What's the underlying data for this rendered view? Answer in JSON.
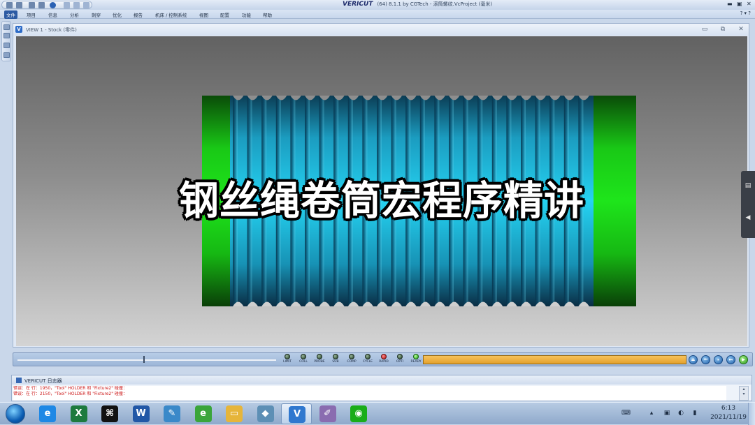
{
  "window": {
    "brand": "VERICUT",
    "title": "(64) 8.1.1 by CGTech - 滚筒螺纹.VcProject (毫米)",
    "controls": {
      "minimize": "▬",
      "restore": "▣",
      "close": "✕"
    }
  },
  "menu": {
    "items": [
      {
        "label": "文件",
        "active": true
      },
      {
        "label": "项目"
      },
      {
        "label": "信息"
      },
      {
        "label": "分析"
      },
      {
        "label": "刺穿"
      },
      {
        "label": "优化"
      },
      {
        "label": "报告"
      },
      {
        "label": "机床 / 控制系统"
      },
      {
        "label": "视图"
      },
      {
        "label": "配置"
      },
      {
        "label": "功能"
      },
      {
        "label": "帮助"
      }
    ],
    "help_icons": "? ▾ ?"
  },
  "view": {
    "title": "VIEW 1 - Stock (零件)",
    "icon_letter": "V",
    "controls": {
      "minimize": "▭",
      "restore": "⧉",
      "close": "✕"
    }
  },
  "overlay": {
    "title": "钢丝绳卷筒宏程序精讲"
  },
  "model": {
    "colors": {
      "green": "#19d313",
      "cyan": "#1ec6e8",
      "dark": "#0a2d44"
    }
  },
  "status_bar": {
    "slider_position": 0.5,
    "leds": [
      {
        "label": "LIMIT",
        "state": "off"
      },
      {
        "label": "COLL",
        "state": "off"
      },
      {
        "label": "PROBE",
        "state": "off"
      },
      {
        "label": "SUB",
        "state": "off"
      },
      {
        "label": "COMP",
        "state": "off"
      },
      {
        "label": "CYCLE",
        "state": "off"
      },
      {
        "label": "RAPID",
        "state": "red"
      },
      {
        "label": "OPTI",
        "state": "off"
      },
      {
        "label": "READY",
        "state": "green"
      }
    ],
    "progress_percent": 100,
    "progress_color": "#eaa735",
    "playback": [
      "⏏",
      "⏮",
      "⏸",
      "⏭",
      "▶"
    ]
  },
  "log": {
    "title": "VERICUT 日志器",
    "lines": [
      "错误：在 行：1950，\"Tool\" HOLDER 和 \"Fixture2\" 碰撞：",
      "错误：在 行：2150，\"Tool\" HOLDER 和 \"Fixture2\" 碰撞："
    ],
    "scroll_up": "▴",
    "scroll_down": "▾"
  },
  "taskbar": {
    "apps": [
      {
        "name": "ie-icon",
        "glyph": "e",
        "color": "#1e88e5"
      },
      {
        "name": "excel-icon",
        "glyph": "X",
        "color": "#1d7a3e"
      },
      {
        "name": "capcut-icon",
        "glyph": "⌘",
        "color": "#111111"
      },
      {
        "name": "word-icon",
        "glyph": "W",
        "color": "#2157a6"
      },
      {
        "name": "network-tool-icon",
        "glyph": "✎",
        "color": "#3a89c9"
      },
      {
        "name": "browser-icon",
        "glyph": "e",
        "color": "#3aa53a"
      },
      {
        "name": "folder-icon",
        "glyph": "▭",
        "color": "#e6b53a"
      },
      {
        "name": "app-icon",
        "glyph": "◆",
        "color": "#5d8fb5"
      },
      {
        "name": "vericut-icon",
        "glyph": "V",
        "color": "#2f78cf",
        "active": true
      },
      {
        "name": "paint-icon",
        "glyph": "✐",
        "color": "#8a6cb0"
      },
      {
        "name": "wechat-icon",
        "glyph": "◉",
        "color": "#1aad19"
      }
    ],
    "clock_time": "6:13",
    "clock_date": "2021/11/19"
  }
}
